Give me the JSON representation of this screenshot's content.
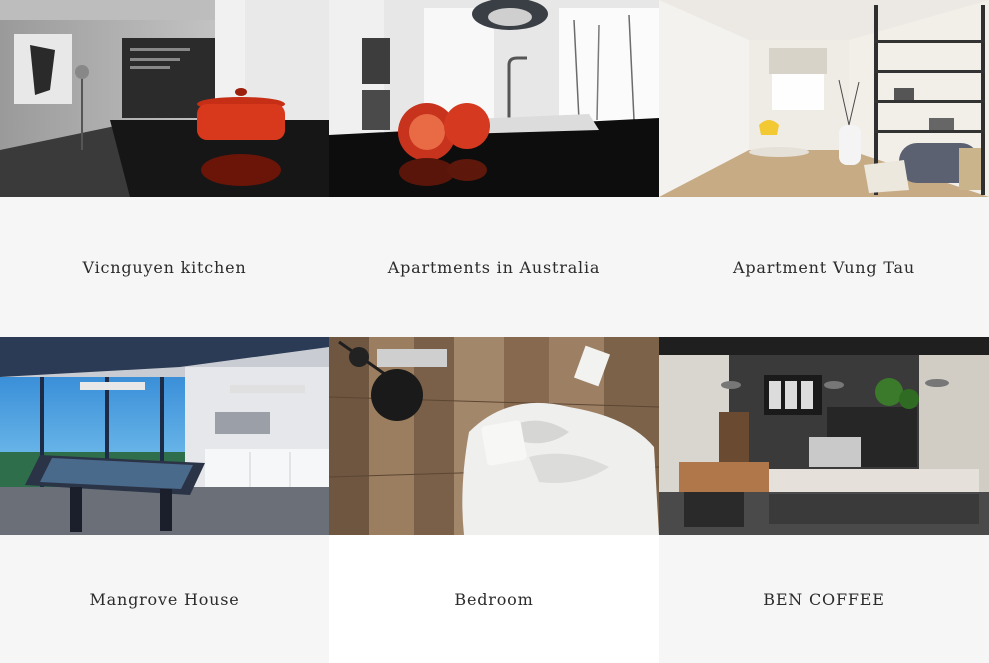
{
  "projects": [
    {
      "title": "Vicnguyen kitchen",
      "image": "kitchen-red-pot-photo",
      "caption_bg": "#f6f6f6"
    },
    {
      "title": "Apartments in Australia",
      "image": "kitchen-tomatoes-photo",
      "caption_bg": "#f6f6f6"
    },
    {
      "title": "Apartment Vung Tau",
      "image": "living-room-corridor-photo",
      "caption_bg": "#f6f6f6"
    },
    {
      "title": "Mangrove House",
      "image": "billiard-room-photo",
      "caption_bg": "#f6f6f6"
    },
    {
      "title": "Bedroom",
      "image": "bedroom-topdown-photo",
      "caption_bg": "#ffffff"
    },
    {
      "title": "BEN COFFEE",
      "image": "coffee-shop-photo",
      "caption_bg": "#f6f6f6"
    }
  ]
}
